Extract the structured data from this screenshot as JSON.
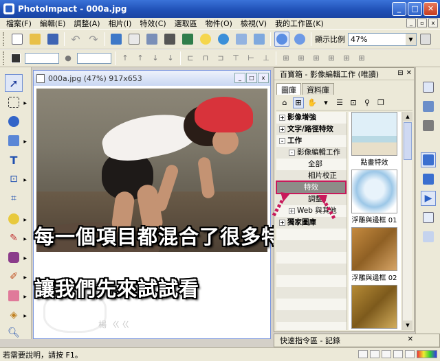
{
  "window": {
    "app_name": "PhotoImpact - 000a.jpg"
  },
  "menubar": {
    "items": [
      "檔案(F)",
      "編輯(E)",
      "調整(A)",
      "相片(I)",
      "特效(C)",
      "選取區",
      "物件(O)",
      "檢視(V)",
      "我的工作區(K)"
    ]
  },
  "toolbar": {
    "zoom_label": "顯示比例",
    "zoom_value": "47%"
  },
  "image_window": {
    "title": "000a.jpg (47%) 917x653",
    "watermark": "楊 ㄍㄍ"
  },
  "overlay": {
    "line1": "每一個項目都混合了很多特效",
    "line2": "讓我們先來試試看"
  },
  "panel": {
    "title": "百寶箱 - 影像編輯工作 (唯讀)",
    "tabs": [
      "圖庫",
      "資料庫"
    ],
    "tree": [
      {
        "label": "影像增強",
        "bold": true,
        "expander": "+"
      },
      {
        "label": "文字/路徑特效",
        "bold": true,
        "expander": "+"
      },
      {
        "label": "工作",
        "bold": true,
        "expander": "-"
      },
      {
        "label": "影像編輯工作",
        "bold": false,
        "expander": "-"
      },
      {
        "label": "全部",
        "bold": false,
        "expander": ""
      },
      {
        "label": "相片校正",
        "bold": false,
        "expander": ""
      },
      {
        "label": "特效",
        "bold": false,
        "expander": "",
        "selected": true
      },
      {
        "label": "調整",
        "bold": false,
        "expander": ""
      },
      {
        "label": "Web 與其他",
        "bold": false,
        "expander": "+"
      },
      {
        "label": "獨家圖庫",
        "bold": true,
        "expander": "+"
      }
    ],
    "thumbnails": [
      {
        "caption": "點畫特效"
      },
      {
        "caption": "浮雕與邊框 01"
      },
      {
        "caption": "浮雕與邊框 02"
      },
      {
        "caption": ""
      }
    ]
  },
  "quick_panel": {
    "title": "快速指令區 - 記錄"
  },
  "statusbar": {
    "help_text": "若需要說明，請按 F1。"
  },
  "colors": {
    "title_bar": "#1f4fb5",
    "selection_highlight": "#8d8c88",
    "annotation_pink": "#c8195b",
    "cap_red": "#d8333b"
  }
}
